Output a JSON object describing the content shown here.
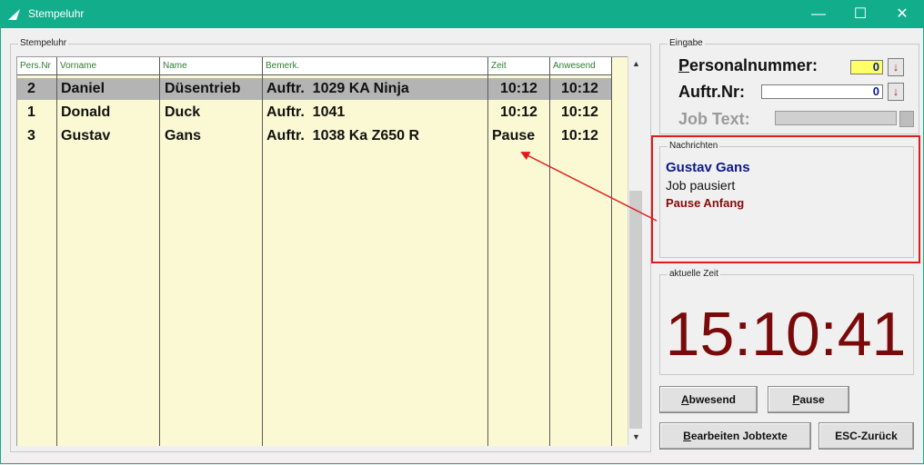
{
  "window": {
    "title": "Stempeluhr",
    "minimize_glyph": "—",
    "maximize_glyph": "☐",
    "close_glyph": "✕"
  },
  "left_group": {
    "label": "Stempeluhr"
  },
  "table": {
    "columns": [
      "Pers.Nr",
      "Vorname",
      "Name",
      "Bemerk.",
      "Zeit",
      "Anwesend"
    ],
    "rows": [
      {
        "pers_nr": "2",
        "vorname": "Daniel",
        "name": "Düsentrieb",
        "bemerk": "Auftr.  1029 KA Ninja",
        "zeit": "10:12",
        "anwesend": "10:12",
        "selected": true
      },
      {
        "pers_nr": "1",
        "vorname": "Donald",
        "name": "Duck",
        "bemerk": "Auftr.  1041",
        "zeit": "10:12",
        "anwesend": "10:12",
        "selected": false
      },
      {
        "pers_nr": "3",
        "vorname": "Gustav",
        "name": "Gans",
        "bemerk": "Auftr.  1038 Ka Z650 R",
        "zeit": "Pause",
        "anwesend": "10:12",
        "selected": false
      }
    ]
  },
  "scrollbar": {
    "up_glyph": "▲",
    "down_glyph": "▼"
  },
  "eingabe": {
    "label": "Eingabe",
    "personalnummer_label_accel": "P",
    "personalnummer_label_rest": "ersonalnummer:",
    "personalnummer_value": "0",
    "auftr_label": "Auftr.Nr:",
    "auftr_value": "0",
    "jobtext_label": "Job Text:",
    "spin_glyph": "↓"
  },
  "nachrichten": {
    "label": "Nachrichten",
    "name": "Gustav Gans",
    "line2": "Job pausiert",
    "line3": "Pause Anfang"
  },
  "zeit": {
    "label": "aktuelle Zeit",
    "value": "15:10:41"
  },
  "buttons": {
    "abwesend_accel": "A",
    "abwesend_rest": "bwesend",
    "pause_accel": "P",
    "pause_rest": "ause",
    "bearbeiten_accel": "B",
    "bearbeiten_rest": "earbeiten Jobtexte",
    "esc_label": "ESC-Zurück"
  },
  "colors": {
    "titlebar": "#12ae8c",
    "grid_bg": "#fbf9d4",
    "highlight": "#e01b1b",
    "clock": "#7a0a0a"
  }
}
